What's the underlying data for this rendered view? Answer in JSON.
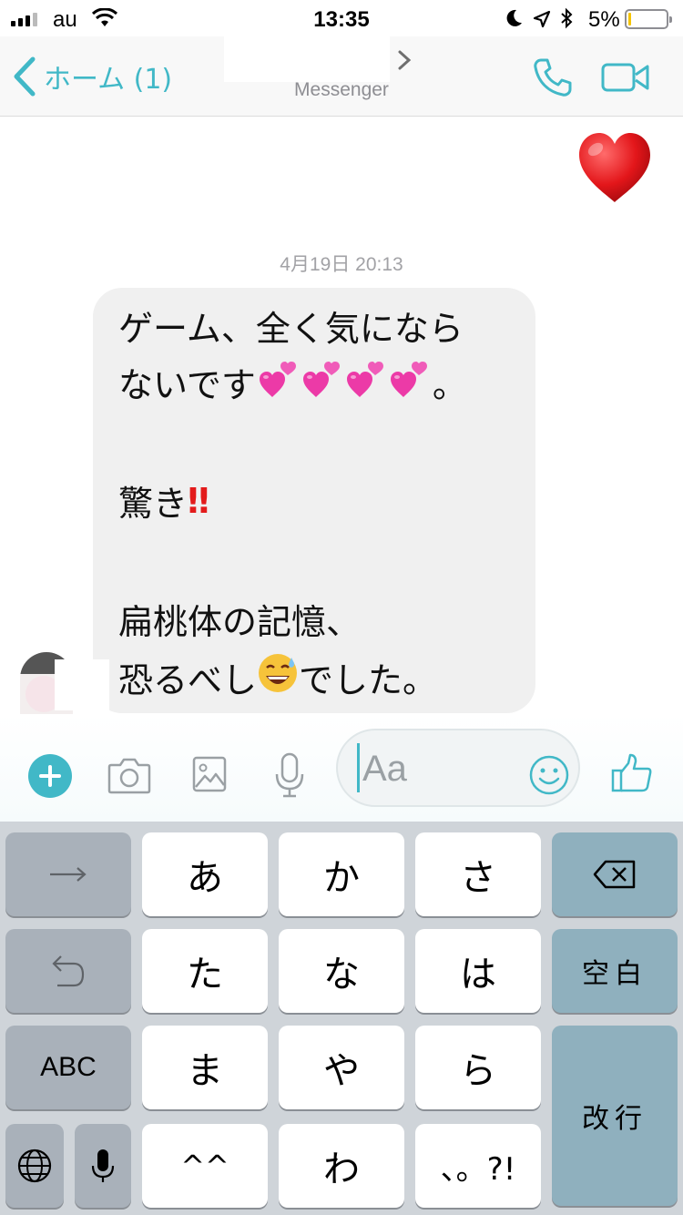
{
  "status_bar": {
    "carrier": "au",
    "time": "13:35",
    "battery_text": "5%",
    "battery_level": 0.05
  },
  "nav": {
    "back_label": "ホーム (1)",
    "subtitle": "Messenger",
    "accent_color": "#41b8c7"
  },
  "conversation": {
    "sent_emoji": "❤️",
    "timestamp": "4月19日 20:13",
    "message_lines": [
      "ゲーム、全く気にならない",
      "ないです",
      "。",
      "驚き",
      "‼",
      "扁桃体の記憶、",
      "恐るべし",
      "でした。"
    ],
    "message_part1": "ゲーム、全く気にならない",
    "line1": "ゲーム、全く気になら",
    "line2_text": "ないです",
    "line2_end": "。",
    "heart_emoji": "💕",
    "line3_text": "驚き",
    "line3_emoji": "‼️",
    "line4": "扁桃体の記憶、",
    "line5_text": "恐るべし",
    "line5_emoji": "😅",
    "line5_end": "でした。"
  },
  "composer": {
    "placeholder": "Aa"
  },
  "keyboard": {
    "row1": [
      "→",
      "あ",
      "か",
      "さ"
    ],
    "row2": [
      "た",
      "な",
      "は",
      "空白"
    ],
    "row3": [
      "ABC",
      "ま",
      "や",
      "ら",
      "改行"
    ],
    "row4": [
      "^^",
      "わ",
      "、。?!"
    ],
    "kana": {
      "a": "あ",
      "ka": "か",
      "sa": "さ",
      "ta": "た",
      "na": "な",
      "ha": "は",
      "ma": "ま",
      "ya": "や",
      "ra": "ら",
      "wa": "わ",
      "caret": "^^",
      "punct": "、。?!"
    },
    "space": "空白",
    "enter": "改行",
    "abc": "ABC"
  }
}
